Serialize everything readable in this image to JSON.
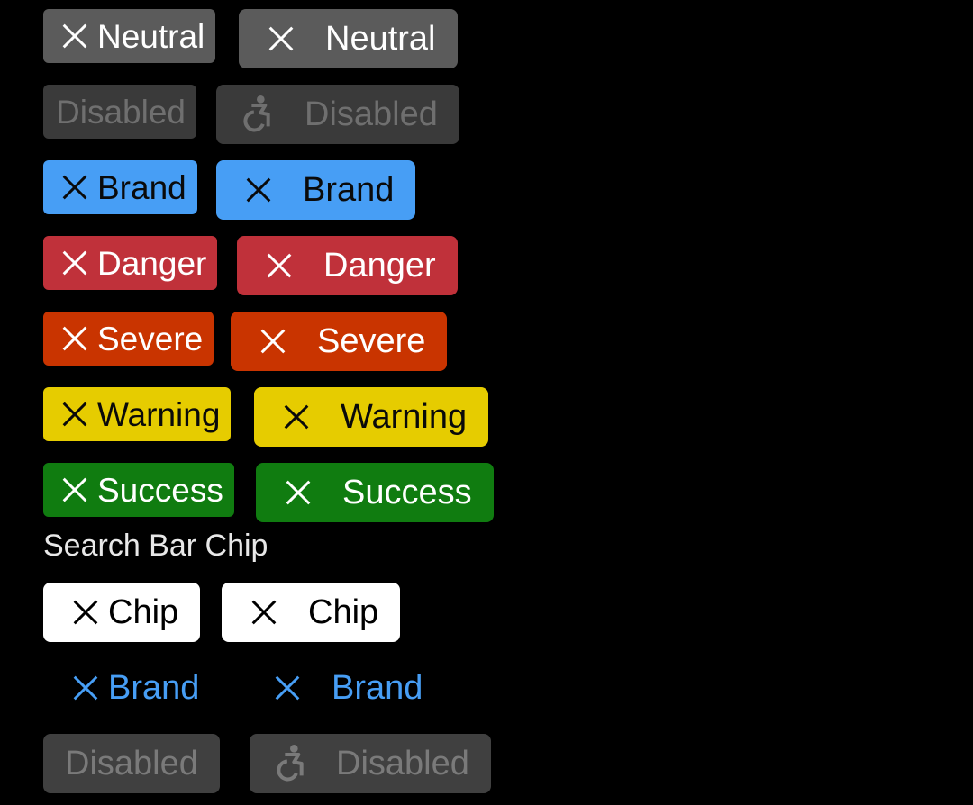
{
  "rows": {
    "neutral": {
      "small": "Neutral",
      "large": "Neutral"
    },
    "disabled": {
      "small": "Disabled",
      "large": "Disabled"
    },
    "brand": {
      "small": "Brand",
      "large": "Brand"
    },
    "danger": {
      "small": "Danger",
      "large": "Danger"
    },
    "severe": {
      "small": "Severe",
      "large": "Severe"
    },
    "warning": {
      "small": "Warning",
      "large": "Warning"
    },
    "success": {
      "small": "Success",
      "large": "Success"
    }
  },
  "search_bar": {
    "title": "Search Bar Chip",
    "chip": {
      "small": "Chip",
      "large": "Chip"
    },
    "brand": {
      "small": "Brand",
      "large": "Brand"
    },
    "disabled": {
      "small": "Disabled",
      "large": "Disabled"
    }
  },
  "icons": {
    "dismiss": "close-icon",
    "accessibility": "accessibility-icon"
  },
  "colors": {
    "neutral": "#5b5b5b",
    "disabled": "#3a3a3a",
    "brand": "#479ef5",
    "danger": "#c0313a",
    "severe": "#c93400",
    "warning": "#e6cc00",
    "success": "#107c10",
    "chip": "#ffffff"
  }
}
